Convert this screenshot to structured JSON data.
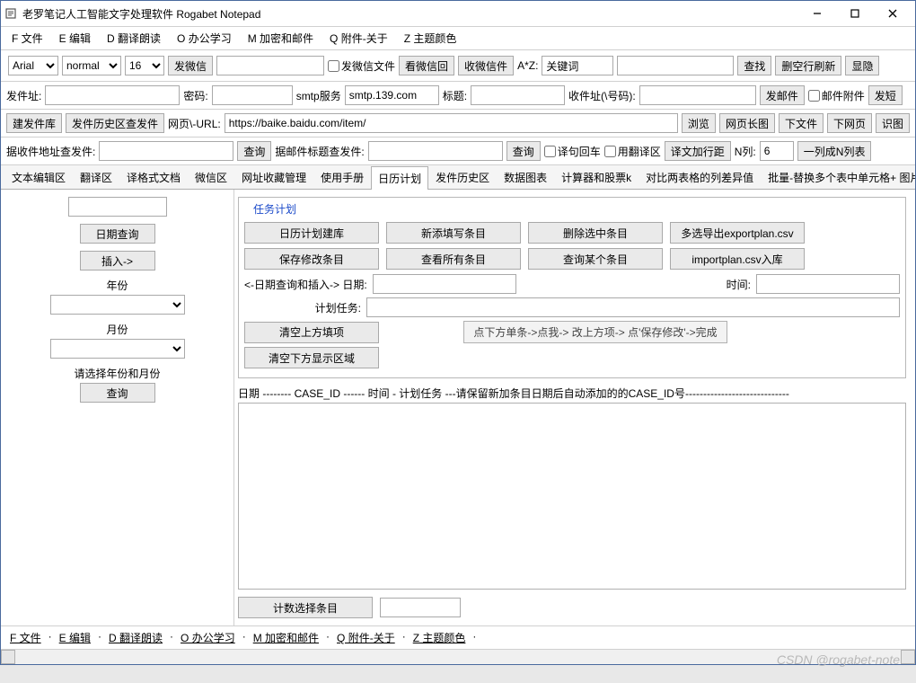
{
  "window": {
    "title": "老罗笔记人工智能文字处理软件 Rogabet Notepad"
  },
  "menubar": [
    "F 文件",
    "E 编辑",
    "D 翻译朗读",
    "O 办公学习",
    "M 加密和邮件",
    "Q 附件-关于",
    "Z 主题颜色"
  ],
  "toolbar": {
    "font": "Arial",
    "weight": "normal",
    "size": "16",
    "btn_sendwx": "发微信",
    "chk_wxfile": "发微信文件",
    "btn_viewwxback": "看微信回",
    "btn_recvwxfile": "收微信件",
    "az_label": "A*Z:",
    "keyword_ph": "关键词",
    "btn_find": "查找",
    "btn_flush": "删空行刷新",
    "btn_hide": "显隐"
  },
  "mailbar": {
    "from": "发件址:",
    "pwd": "密码:",
    "smtp": "smtp服务",
    "smtp_val": "smtp.139.com",
    "subject": "标题:",
    "to": "收件址(\\号码):",
    "btn_send": "发邮件",
    "chk_attach": "邮件附件",
    "btn_short": "发短"
  },
  "urlbar": {
    "btn_buildlib": "建发件库",
    "btn_histfind": "发件历史区查发件",
    "url_label": "网页\\-URL:",
    "url_val": "https://baike.baidu.com/item/",
    "btn_browse": "浏览",
    "btn_longshot": "网页长图",
    "btn_dlfile": "下文件",
    "btn_dlpage": "下网页",
    "btn_ocr": "识图"
  },
  "searchbar": {
    "lbl1": "据收件地址查发件:",
    "btn_q1": "查询",
    "lbl2": "据邮件标题查发件:",
    "btn_q2": "查询",
    "chk_newline": "译句回车",
    "chk_usetr": "用翻译区",
    "btn_addspace": "译文加行距",
    "nlabel": "N列:",
    "nval": "6",
    "btn_split": "一列成N列表"
  },
  "tabs": [
    "文本编辑区",
    "翻译区",
    "译格式文档",
    "微信区",
    "网址收藏管理",
    "使用手册",
    "日历计划",
    "发件历史区",
    "数据图表",
    "计算器和股票k",
    "对比两表格的列差异值",
    "批量-替换多个表中单元格+ 图片取文本"
  ],
  "active_tab": 6,
  "side": {
    "btn_datequery": "日期查询",
    "btn_insert": "插入->",
    "lbl_year": "年份",
    "lbl_month": "月份",
    "lbl_prompt": "请选择年份和月份",
    "btn_query": "查询"
  },
  "panel": {
    "legend": "任务计划",
    "r1": [
      "日历计划建库",
      "新添填写条目",
      "删除选中条目",
      "多选导出exportplan.csv"
    ],
    "r2": [
      "保存修改条目",
      "查看所有条目",
      "查询某个条目",
      "importplan.csv入库"
    ],
    "date_lbl": "<-日期查询和插入-> 日期:",
    "time_lbl": "时间:",
    "task_lbl": "计划任务:",
    "btn_clear_up": "清空上方填项",
    "btn_clear_down": "清空下方显示区域",
    "hint": "点下方单条->点我-> 改上方项-> 点'保存修改'->完成",
    "list_header": "日期 -------- CASE_ID ------ 时间 - 计划任务  ---请保留新加条目日期后自动添加的的CASE_ID号-----------------------------",
    "btn_count": "计数选择条目"
  },
  "statusbar": [
    "F 文件",
    "E 编辑",
    "D 翻译朗读",
    "O 办公学习",
    "M 加密和邮件",
    "Q 附件-关于",
    "Z 主题颜色"
  ],
  "watermark": "CSDN @rogabet-note"
}
